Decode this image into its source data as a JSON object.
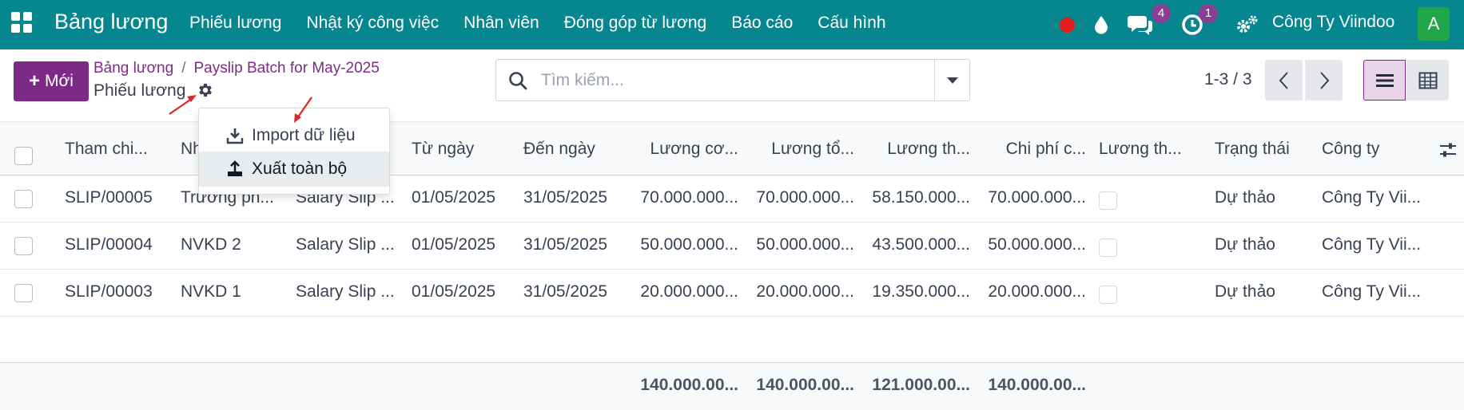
{
  "navbar": {
    "brand": "Bảng lương",
    "menu": [
      "Phiếu lương",
      "Nhật ký công việc",
      "Nhân viên",
      "Đóng góp từ lương",
      "Báo cáo",
      "Cấu hình"
    ],
    "chat_badge": "4",
    "activity_badge": "1",
    "company": "Công Ty Viindoo",
    "avatar_letter": "A"
  },
  "control": {
    "new_label": "Mới",
    "breadcrumb": [
      "Bảng lương",
      "Payslip Batch for May-2025"
    ],
    "breadcrumb_sep": "/",
    "title": "Phiếu lương",
    "search_placeholder": "Tìm kiếm...",
    "pager": "1-3 / 3"
  },
  "gear_menu": {
    "items": [
      "Import dữ liệu",
      "Xuất toàn bộ"
    ]
  },
  "table": {
    "headers": [
      "Tham chi...",
      "Nh",
      "",
      "Từ ngày",
      "Đến ngày",
      "Lương cơ...",
      "Lương tổ...",
      "Lương th...",
      "Chi phí c...",
      "Lương th...",
      "Trạng thái",
      "Công ty"
    ],
    "rows": [
      {
        "ref": "SLIP/00005",
        "employee": "Trương ph...",
        "structure": "Salary Slip ...",
        "from": "01/05/2025",
        "to": "31/05/2025",
        "basic": "70.000.000...",
        "gross": "70.000.000...",
        "net": "58.150.000...",
        "cost": "70.000.000...",
        "state": "Dự thảo",
        "company": "Công Ty Vii..."
      },
      {
        "ref": "SLIP/00004",
        "employee": "NVKD 2",
        "structure": "Salary Slip ...",
        "from": "01/05/2025",
        "to": "31/05/2025",
        "basic": "50.000.000...",
        "gross": "50.000.000...",
        "net": "43.500.000...",
        "cost": "50.000.000...",
        "state": "Dự thảo",
        "company": "Công Ty Vii..."
      },
      {
        "ref": "SLIP/00003",
        "employee": "NVKD 1",
        "structure": "Salary Slip ...",
        "from": "01/05/2025",
        "to": "31/05/2025",
        "basic": "20.000.000...",
        "gross": "20.000.000...",
        "net": "19.350.000...",
        "cost": "20.000.000...",
        "state": "Dự thảo",
        "company": "Công Ty Vii..."
      }
    ],
    "totals": [
      "140.000.00...",
      "140.000.00...",
      "121.000.00...",
      "140.000.00..."
    ]
  },
  "colors": {
    "navbar": "#06878f",
    "primary": "#7c2a86",
    "badge": "#8a3f97",
    "record_dot": "#e11d1d",
    "avatar": "#20a548",
    "arrow": "#dc2626"
  },
  "icons": {
    "apps": "apps-grid-icon",
    "record": "record-dot-icon",
    "drop": "water-drop-icon",
    "chat": "chat-icon",
    "activity": "clock-icon",
    "settings": "gears-icon",
    "search": "search-icon",
    "import": "download-icon",
    "export": "upload-icon",
    "list_view": "list-view-icon",
    "pivot_view": "table-view-icon",
    "column_options": "sliders-icon"
  }
}
